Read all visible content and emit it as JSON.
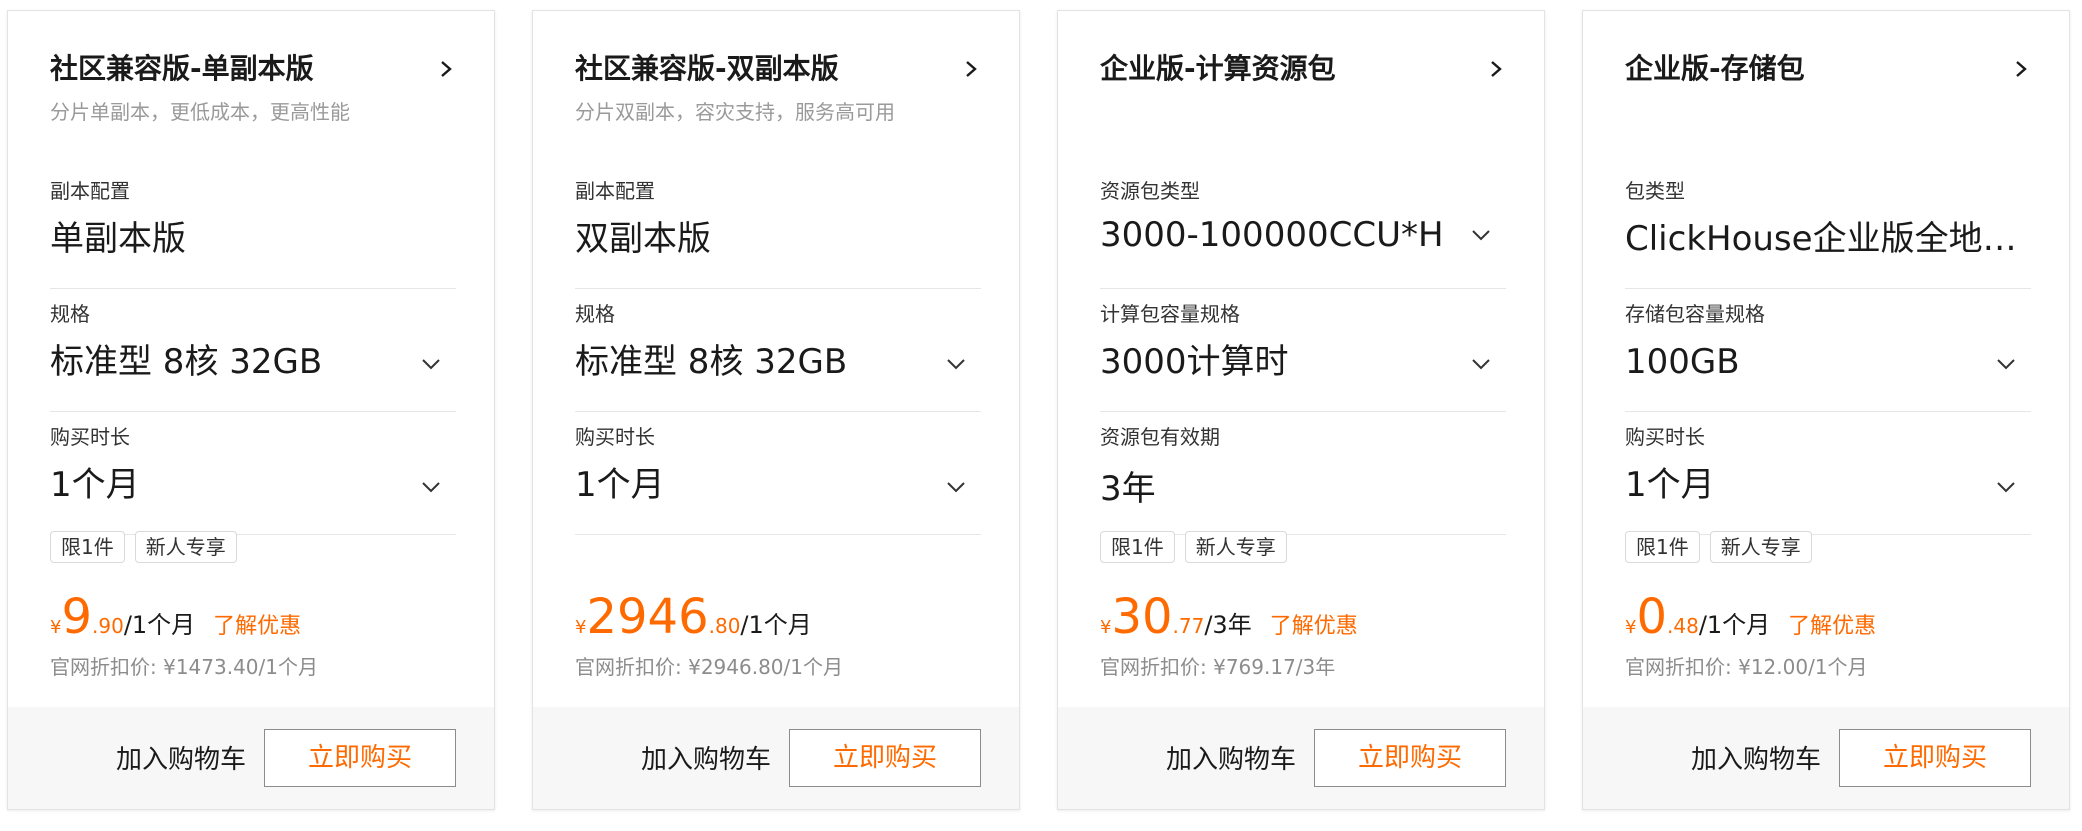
{
  "colors": {
    "accent": "#ff6a00",
    "muted": "#9a9a9a",
    "footer_bg": "#f7f7f7",
    "border": "#e3e3e3"
  },
  "icons": {
    "arrow": "chevron-right-icon",
    "dropdown": "chevron-down-icon"
  },
  "cards": [
    {
      "title": "社区兼容版-单副本版",
      "subtitle": "分片单副本，更低成本，更高性能",
      "fields": [
        {
          "label": "副本配置",
          "value": "单副本版",
          "has_dropdown": false
        },
        {
          "label": "规格",
          "value": "标准型 8核 32GB",
          "has_dropdown": true
        },
        {
          "label": "购买时长",
          "value": "1个月",
          "has_dropdown": true
        }
      ],
      "tags": [
        "限1件",
        "新人专享"
      ],
      "price": {
        "symbol": "¥",
        "integer": "9",
        "decimal": ".90",
        "unit": "/1个月"
      },
      "promo_link": "了解优惠",
      "original_price": "官网折扣价: ¥1473.40/1个月",
      "cart_label": "加入购物车",
      "buy_label": "立即购买"
    },
    {
      "title": "社区兼容版-双副本版",
      "subtitle": "分片双副本，容灾支持，服务高可用",
      "fields": [
        {
          "label": "副本配置",
          "value": "双副本版",
          "has_dropdown": false
        },
        {
          "label": "规格",
          "value": "标准型 8核 32GB",
          "has_dropdown": true
        },
        {
          "label": "购买时长",
          "value": "1个月",
          "has_dropdown": true
        }
      ],
      "tags": [],
      "price": {
        "symbol": "¥",
        "integer": "2946",
        "decimal": ".80",
        "unit": "/1个月"
      },
      "promo_link": "",
      "original_price": "官网折扣价: ¥2946.80/1个月",
      "cart_label": "加入购物车",
      "buy_label": "立即购买"
    },
    {
      "title": "企业版-计算资源包",
      "subtitle": "",
      "fields": [
        {
          "label": "资源包类型",
          "value": "3000-100000CCU*H",
          "has_dropdown": true
        },
        {
          "label": "计算包容量规格",
          "value": "3000计算时",
          "has_dropdown": true
        },
        {
          "label": "资源包有效期",
          "value": "3年",
          "has_dropdown": false
        }
      ],
      "tags": [
        "限1件",
        "新人专享"
      ],
      "price": {
        "symbol": "¥",
        "integer": "30",
        "decimal": ".77",
        "unit": "/3年"
      },
      "promo_link": "了解优惠",
      "original_price": "官网折扣价: ¥769.17/3年",
      "cart_label": "加入购物车",
      "buy_label": "立即购买"
    },
    {
      "title": "企业版-存储包",
      "subtitle": "",
      "fields": [
        {
          "label": "包类型",
          "value": "ClickHouse企业版全地域存储包",
          "has_dropdown": false
        },
        {
          "label": "存储包容量规格",
          "value": "100GB",
          "has_dropdown": true
        },
        {
          "label": "购买时长",
          "value": "1个月",
          "has_dropdown": true
        }
      ],
      "tags": [
        "限1件",
        "新人专享"
      ],
      "price": {
        "symbol": "¥",
        "integer": "0",
        "decimal": ".48",
        "unit": "/1个月"
      },
      "promo_link": "了解优惠",
      "original_price": "官网折扣价: ¥12.00/1个月",
      "cart_label": "加入购物车",
      "buy_label": "立即购买"
    }
  ]
}
